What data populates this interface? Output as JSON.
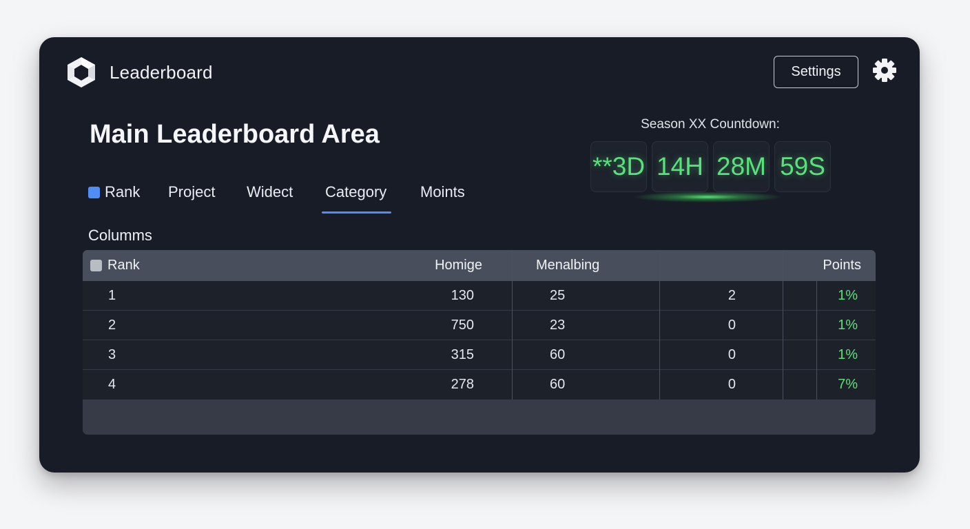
{
  "app": {
    "title": "Leaderboard",
    "logo_icon": "hexagon-cube-logo"
  },
  "header": {
    "settings_label": "Settings",
    "gear_icon": "gear-icon"
  },
  "main": {
    "title": "Main Leaderboard Area"
  },
  "countdown": {
    "label": "Season XX Countdown:",
    "days": "**3D",
    "hours": "14H",
    "minutes": "28M",
    "seconds": "59S",
    "color": "#59e27b"
  },
  "tabs": [
    {
      "label": "Rank",
      "marker_color": "#4f8ff5"
    },
    {
      "label": "Project"
    },
    {
      "label": "Widect"
    },
    {
      "label": "Category",
      "active": true
    },
    {
      "label": "Moints"
    }
  ],
  "section_label": "Columms",
  "table": {
    "headers": [
      "Rank",
      "Homige",
      "Menalbing",
      "",
      "Points"
    ],
    "rows": [
      [
        "1",
        "130",
        "25",
        "2",
        "1%"
      ],
      [
        "2",
        "750",
        "23",
        "0",
        "1%"
      ],
      [
        "3",
        "315",
        "60",
        "0",
        "1%"
      ],
      [
        "4",
        "278",
        "60",
        "0",
        "7%"
      ]
    ]
  },
  "colors": {
    "accent": "#4f8ff5",
    "positive": "#5ee07a",
    "panel": "#181c26"
  }
}
